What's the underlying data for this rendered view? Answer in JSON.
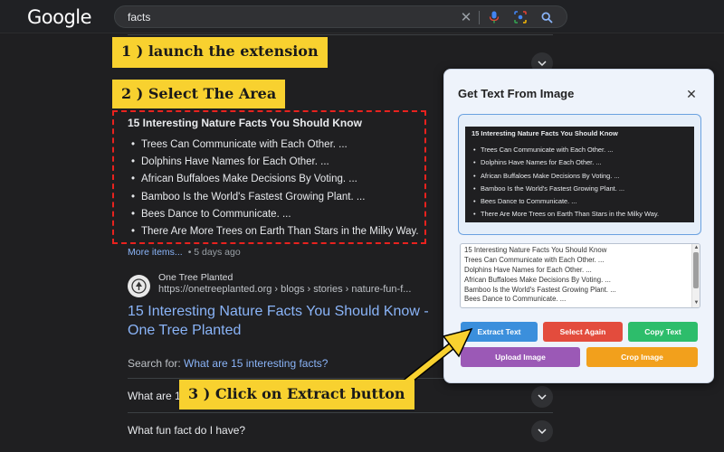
{
  "header": {
    "logo": "Google",
    "search_value": "facts"
  },
  "banners": {
    "step1": "1 ) launch the extension",
    "step2": "2 ) Select The Area",
    "step3": "3 ) Click on Extract button"
  },
  "result": {
    "facts_title": "15 Interesting Nature Facts You Should Know",
    "facts": [
      "Trees Can Communicate with Each Other. ...",
      "Dolphins Have Names for Each Other. ...",
      "African Buffaloes Make Decisions By Voting. ...",
      "Bamboo Is the World's Fastest Growing Plant. ...",
      "Bees Dance to Communicate. ...",
      "There Are More Trees on Earth Than Stars in the Milky Way."
    ],
    "more_items": "More items...",
    "date": "• 5 days ago",
    "site_name": "One Tree Planted",
    "site_url": "https://onetreeplanted.org › blogs › stories › nature-fun-f...",
    "link_title": "15 Interesting Nature Facts You Should Know - One Tree Planted",
    "search_for_label": "Search for:",
    "search_for_link": "What are 15 interesting facts?",
    "paa": [
      "What are 10",
      "What fun fact do I have?"
    ]
  },
  "popup": {
    "title": "Get Text From Image",
    "preview_title": "15 Interesting Nature Facts You Should Know",
    "preview_facts": [
      "Trees Can Communicate with Each Other. ...",
      "Dolphins Have Names for Each Other. ...",
      "African Buffaloes Make Decisions By Voting. ...",
      "Bamboo Is the World's Fastest Growing Plant. ...",
      "Bees Dance to Communicate. ...",
      "There Are More Trees on Earth Than Stars in the Milky Way."
    ],
    "output_lines": [
      "15 Interesting Nature Facts You Should Know",
      "Trees Can Communicate with Each Other. ...",
      "Dolphins Have Names for Each Other. ...",
      "African Buffaloes Make Decisions By Voting. ...",
      "Bamboo Is the World's Fastest Growing Plant. ...",
      "Bees Dance to Communicate. ..."
    ],
    "buttons": {
      "extract": "Extract Text",
      "select_again": "Select Again",
      "copy": "Copy Text",
      "upload": "Upload Image",
      "crop": "Crop Image"
    }
  },
  "colors": {
    "extract": "#3b8fdc",
    "select_again": "#e34c3d",
    "copy": "#2dbd6b",
    "upload": "#9b59b6",
    "crop": "#f2a01c",
    "banner": "#f8d12f"
  }
}
